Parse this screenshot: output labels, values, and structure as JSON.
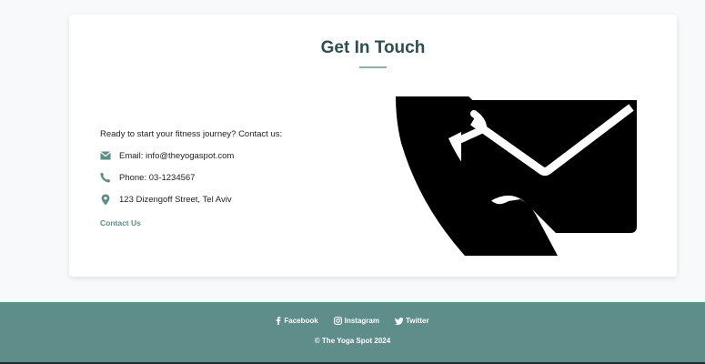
{
  "contact": {
    "title": "Get In Touch",
    "intro": "Ready to start your fitness journey? Contact us:",
    "email": "Email: info@theyogaspot.com",
    "phone": "Phone: 03-1234567",
    "address": "123 Dizengoff Street, Tel Aviv",
    "link_label": "Contact Us",
    "icons": {
      "email": "envelope-icon",
      "phone": "phone-icon",
      "address": "map-marker-icon"
    },
    "illustration": "phone-and-envelope-illustration"
  },
  "footer": {
    "social": [
      {
        "label": "Facebook",
        "icon": "facebook-icon"
      },
      {
        "label": "Instagram",
        "icon": "instagram-icon"
      },
      {
        "label": "Twitter",
        "icon": "twitter-icon"
      }
    ],
    "copyright": "© The Yoga Spot 2024"
  },
  "colors": {
    "accent": "#5f8d8a",
    "title": "#2f4f4f",
    "underline": "#8fb1ac",
    "footer_bg": "#5f8d8a",
    "card_bg": "#ffffff",
    "page_bg": "#f8f9fa"
  }
}
